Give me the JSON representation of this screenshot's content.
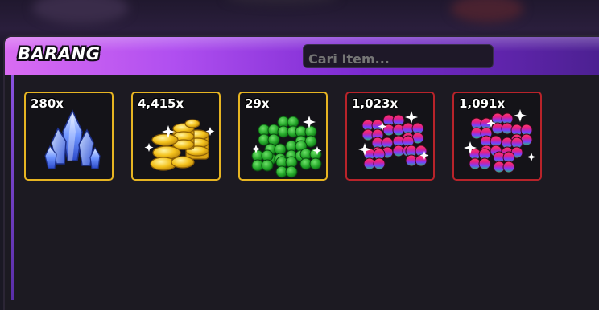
{
  "inventory": {
    "title": "BARANG",
    "search_placeholder": "Cari Item...",
    "items": [
      {
        "count": "280x",
        "icon": "crystal-icon",
        "rarity": "gold"
      },
      {
        "count": "4,415x",
        "icon": "gold-coins-icon",
        "rarity": "gold"
      },
      {
        "count": "29x",
        "icon": "green-clover-icon",
        "rarity": "gold"
      },
      {
        "count": "1,023x",
        "icon": "rainbow-clover-icon",
        "rarity": "red"
      },
      {
        "count": "1,091x",
        "icon": "rainbow-clover-icon",
        "rarity": "red"
      }
    ]
  },
  "colors": {
    "gold_border": "#e6b422",
    "red_border": "#b8232a",
    "header_gradient_start": "#d96cf2",
    "header_gradient_end": "#4b2090"
  }
}
